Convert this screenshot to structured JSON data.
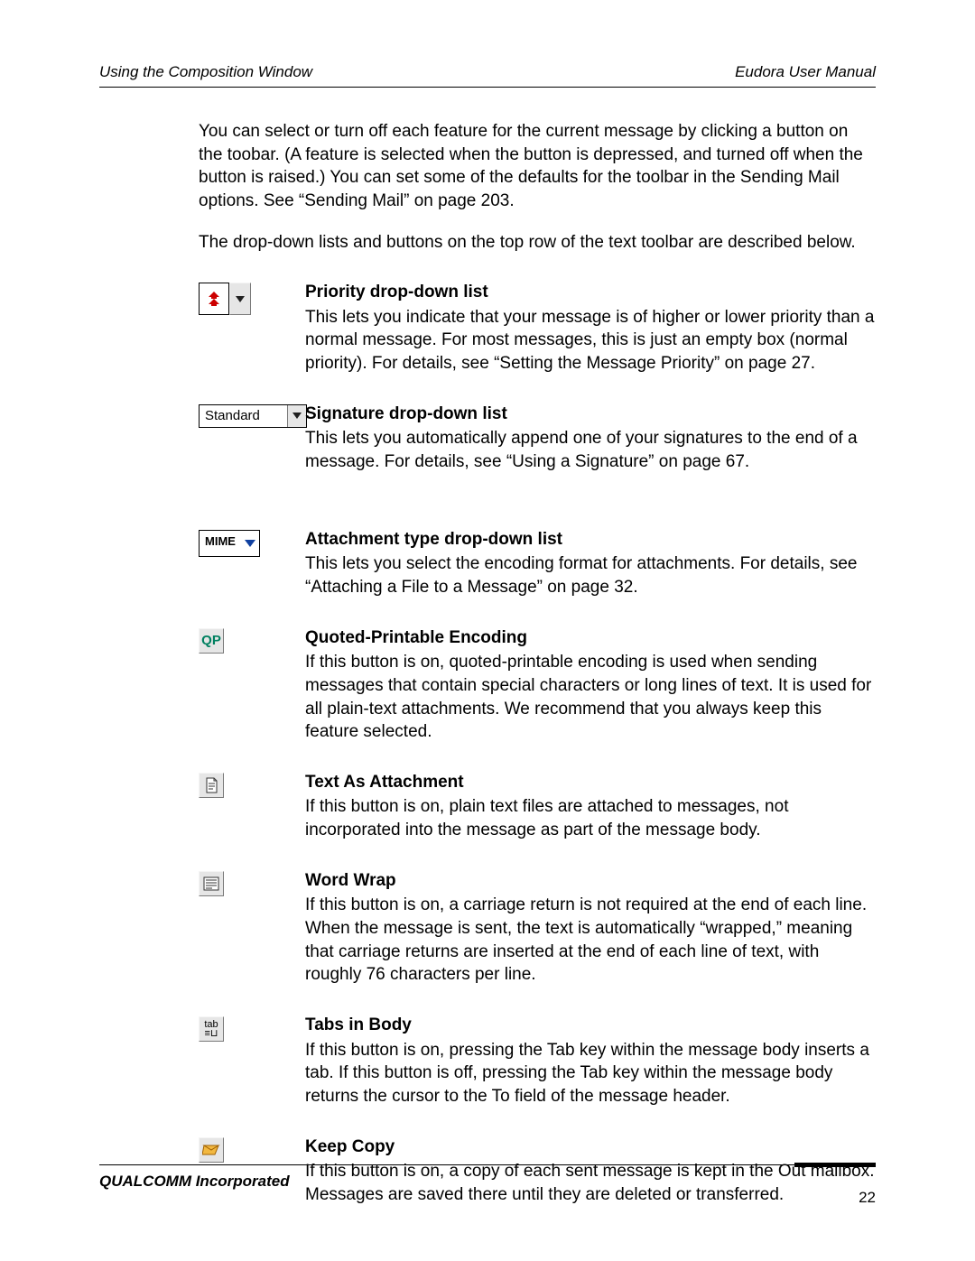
{
  "header": {
    "left": "Using the Composition Window",
    "right": "Eudora User Manual"
  },
  "intro": {
    "p1": "You can select or turn off each feature for the current message by clicking a button on the toobar. (A feature is selected when the button is depressed, and turned off when the button is raised.) You can set some of the defaults for the toolbar in the Sending Mail options. See “Sending Mail” on page 203.",
    "p2": "The drop-down lists and buttons on the top row of the text toolbar are described below."
  },
  "items": [
    {
      "key": "priority",
      "icon_label": "«",
      "title": "Priority drop-down list",
      "body": "This lets you indicate that your message is of higher or lower priority than a normal message. For most messages, this is just an empty box (normal priority). For details, see “Setting the Message Priority” on page 27."
    },
    {
      "key": "signature",
      "icon_label": "Standard",
      "title": "Signature drop-down list",
      "body": "This lets you automatically append one of your signatures to the end of a message. For details, see “Using a Signature” on page 67."
    },
    {
      "key": "attachment",
      "icon_label": "MIME",
      "title": "Attachment type drop-down list",
      "body": "This lets you select the encoding format for attachments. For details, see “Attaching a File to a Message” on page 32."
    },
    {
      "key": "qp",
      "icon_label": "QP",
      "title": "Quoted-Printable Encoding",
      "body": "If this button is on, quoted-printable encoding is used when sending messages that contain special characters or long lines of text. It is used for all plain-text attachments. We recommend that you always keep this feature selected."
    },
    {
      "key": "text_attach",
      "icon_label": "",
      "title": "Text As Attachment",
      "body": "If this button is on, plain text files are attached to messages, not incorporated into the message as part of the message body."
    },
    {
      "key": "word_wrap",
      "icon_label": "",
      "title": "Word Wrap",
      "body": "If this button is on, a carriage return is not required at the end of each line. When the message is sent, the text is automatically “wrapped,” meaning that carriage returns are inserted at the end of each line of text, with roughly 76 characters per line."
    },
    {
      "key": "tabs",
      "icon_label": "tab",
      "title": "Tabs in Body",
      "body": "If this button is on, pressing the Tab key within the message body inserts a tab. If this button is off, pressing the Tab key within the message body returns the cursor to the To field of the message header."
    },
    {
      "key": "keep_copy",
      "icon_label": "",
      "title": "Keep Copy",
      "body": "If this button is on, a copy of each sent message is kept in the Out mailbox. Messages are saved there until they are deleted or transferred."
    }
  ],
  "footer": {
    "company": "QUALCOMM Incorporated",
    "page": "22"
  }
}
